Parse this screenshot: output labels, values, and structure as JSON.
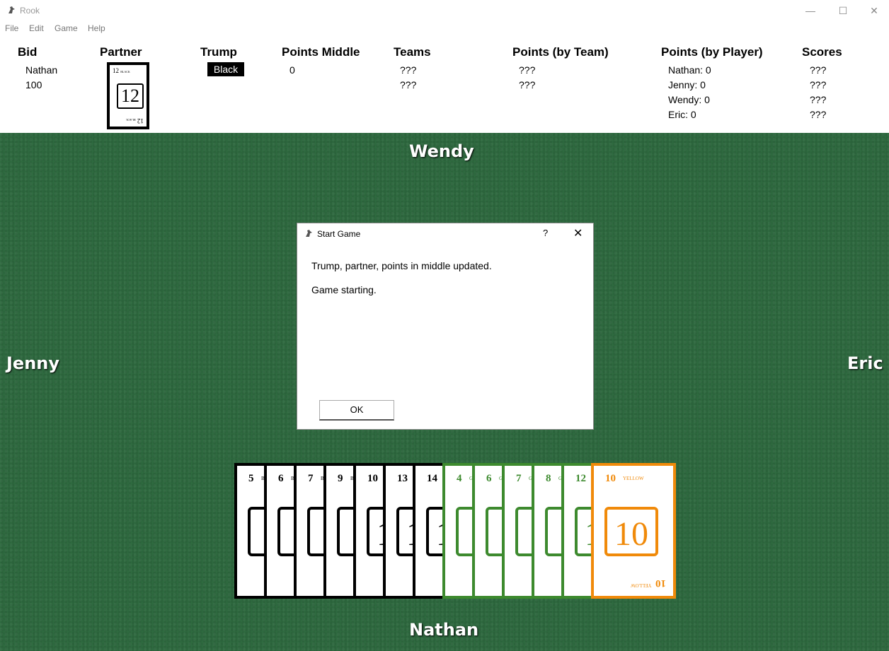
{
  "window": {
    "title": "Rook",
    "controls": {
      "minimize": "—",
      "maximize": "☐",
      "close": "✕"
    }
  },
  "menu": {
    "items": [
      "File",
      "Edit",
      "Game",
      "Help"
    ]
  },
  "info": {
    "headers": {
      "bid": "Bid",
      "partner": "Partner",
      "trump": "Trump",
      "points_middle": "Points Middle",
      "teams": "Teams",
      "points_team": "Points (by Team)",
      "points_player": "Points (by Player)",
      "scores": "Scores"
    },
    "bid": {
      "player": "Nathan",
      "amount": "100"
    },
    "partner_card": {
      "number": "12",
      "color_label": "BLACK",
      "color": "#000000"
    },
    "trump": "Black",
    "points_middle": "0",
    "teams": [
      "???",
      "???"
    ],
    "points_by_team": [
      "???",
      "???"
    ],
    "points_by_player": [
      "Nathan: 0",
      "Jenny: 0",
      "Wendy: 0",
      "Eric: 0"
    ],
    "scores": [
      "???",
      "???",
      "???",
      "???"
    ]
  },
  "table": {
    "players": {
      "top": "Wendy",
      "left": "Jenny",
      "right": "Eric",
      "bottom": "Nathan"
    },
    "hand": [
      {
        "number": "5",
        "label": "BLACK",
        "color": "#000000"
      },
      {
        "number": "6",
        "label": "BLACK",
        "color": "#000000"
      },
      {
        "number": "7",
        "label": "BLACK",
        "color": "#000000"
      },
      {
        "number": "9",
        "label": "BLACK",
        "color": "#000000"
      },
      {
        "number": "10",
        "label": "BLACK",
        "color": "#000000"
      },
      {
        "number": "13",
        "label": "BLACK",
        "color": "#000000"
      },
      {
        "number": "14",
        "label": "BLACK",
        "color": "#000000"
      },
      {
        "number": "4",
        "label": "GREEN",
        "color": "#3d8a2e"
      },
      {
        "number": "6",
        "label": "GREEN",
        "color": "#3d8a2e"
      },
      {
        "number": "7",
        "label": "GREEN",
        "color": "#3d8a2e"
      },
      {
        "number": "8",
        "label": "GREEN",
        "color": "#3d8a2e"
      },
      {
        "number": "12",
        "label": "GREEN",
        "color": "#3d8a2e"
      },
      {
        "number": "10",
        "label": "YELLOW",
        "color": "#f08a0a"
      }
    ]
  },
  "dialog": {
    "title": "Start Game",
    "help": "?",
    "close": "✕",
    "message_line1": "Trump, partner, points in middle updated.",
    "message_line2": "Game starting.",
    "ok_label": "OK"
  }
}
